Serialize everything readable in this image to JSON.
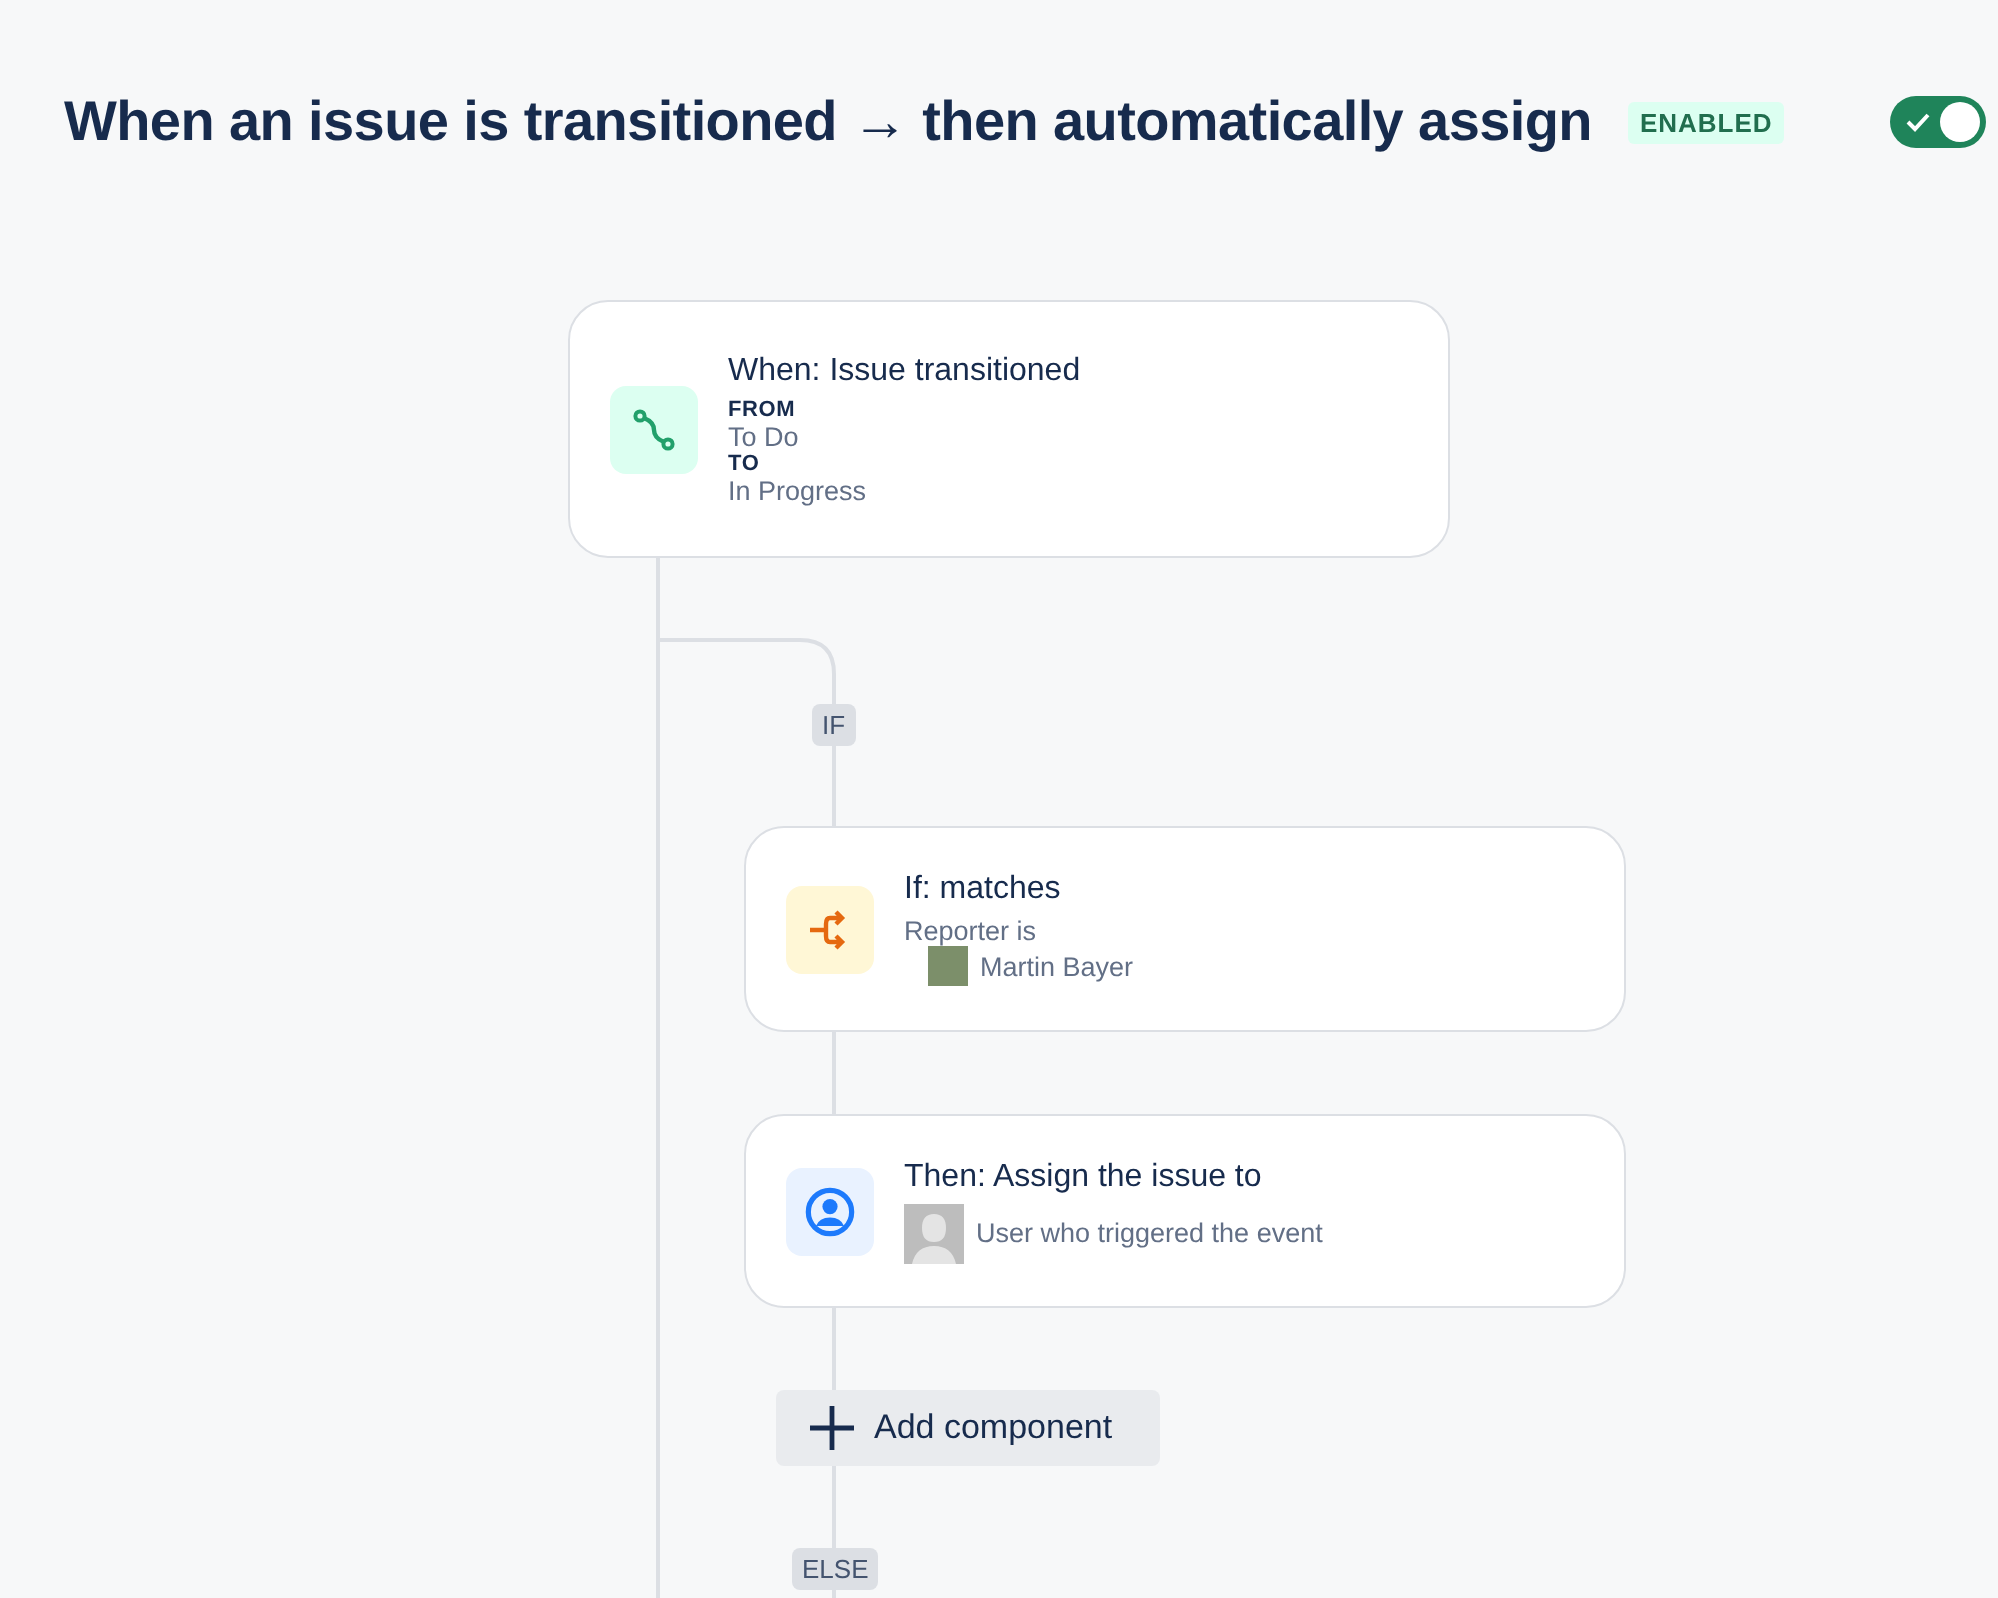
{
  "header": {
    "title": "When an issue is transitioned → then automatically assign",
    "status_badge": "ENABLED",
    "toggle": {
      "on": true
    }
  },
  "nodes": [
    {
      "kind": "trigger",
      "title": "When: Issue transitioned",
      "details": [
        {
          "label": "FROM",
          "value": "To Do"
        },
        {
          "label": "TO",
          "value": "In Progress"
        }
      ]
    },
    {
      "kind": "condition",
      "title": "If: matches",
      "subtitle": "Reporter is",
      "user": {
        "name": "Martin Bayer",
        "kind": "photo"
      }
    },
    {
      "kind": "action",
      "title": "Then: Assign the issue to",
      "user": {
        "name": "User who triggered the event",
        "kind": "unknown"
      }
    }
  ],
  "branch_labels": {
    "if": "IF",
    "else": "ELSE"
  },
  "add_button": "Add component"
}
